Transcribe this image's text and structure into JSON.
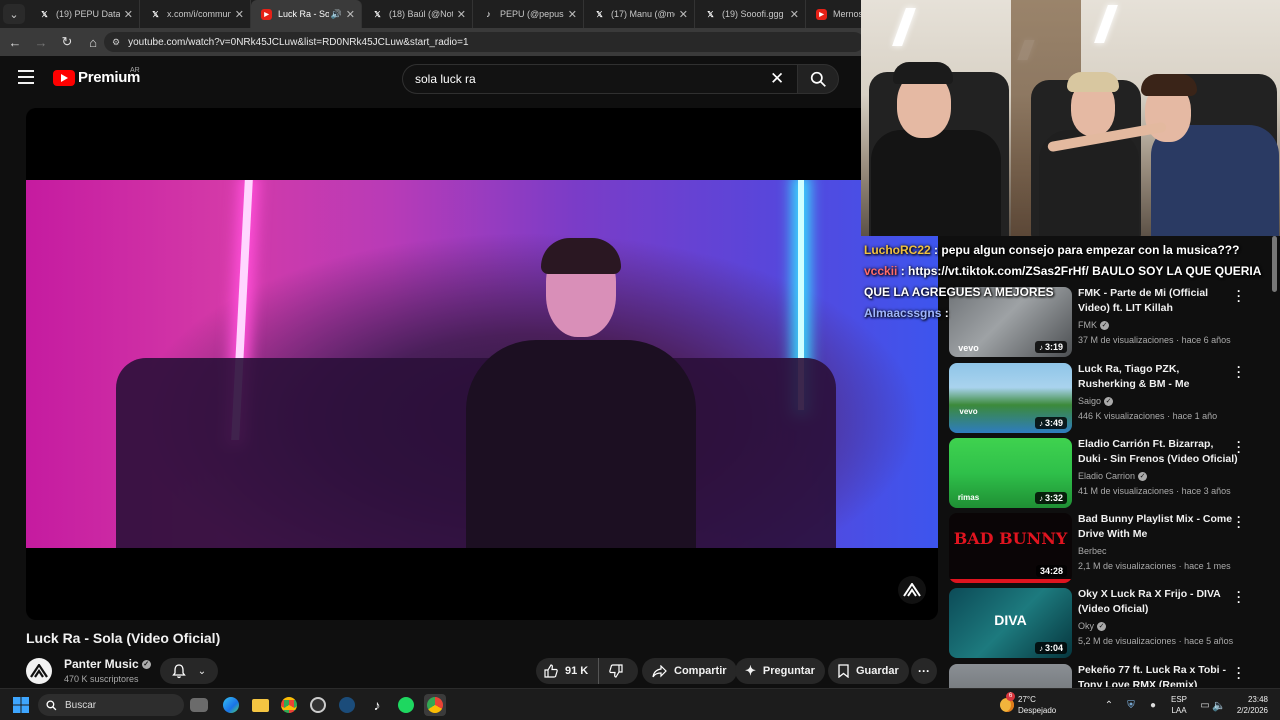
{
  "browser": {
    "tabs": [
      {
        "label": "(19) PEPU Data (@",
        "icon": "x-icon",
        "active": false
      },
      {
        "label": "x.com/i/commun",
        "icon": "x-icon",
        "active": false
      },
      {
        "label": "Luck Ra - Sola",
        "icon": "youtube-icon",
        "active": true
      },
      {
        "label": "(18) Baúl (@NotB",
        "icon": "x-icon",
        "active": false
      },
      {
        "label": "PEPU (@pepuson",
        "icon": "tiktok-icon",
        "active": false
      },
      {
        "label": "(17) Manu (@me",
        "icon": "x-icon",
        "active": false
      },
      {
        "label": "(19) Sooofi.ggg e",
        "icon": "x-icon",
        "active": false
      },
      {
        "label": "Mernosket",
        "icon": "youtube-icon",
        "active": false
      }
    ],
    "url": "youtube.com/watch?v=0NRk45JCLuw&list=RD0NRk45JCLuw&start_radio=1"
  },
  "youtube": {
    "logo_text": "Premium",
    "country_code": "AR",
    "search_value": "sola luck ra"
  },
  "video": {
    "title": "Luck Ra - Sola (Video Oficial)",
    "channel": "Panter Music",
    "subscribers": "470 K suscriptores",
    "likes": "91 K",
    "share_label": "Compartir",
    "ask_label": "Preguntar",
    "save_label": "Guardar"
  },
  "chat": [
    {
      "user": "LuchoRC22",
      "user_color": "#f0c040",
      "message": "pepu algun consejo para empezar con la musica???"
    },
    {
      "user": "vcckii",
      "user_color": "#ff6b6b",
      "message": "https://vt.tiktok.com/ZSas2FrHf/ BAULO SOY LA QUE QUERIA QUE LA AGREGUES A MEJORES"
    },
    {
      "user": "Almaacssgns",
      "user_color": "#9fb6ff",
      "message": ""
    }
  ],
  "recommendations": [
    {
      "title": "FMK - Parte de Mi (Official Video) ft. LIT Killah",
      "channel": "FMK",
      "verified": true,
      "views": "37 M de visualizaciones",
      "age": "hace 6 años",
      "duration": "3:19",
      "thumb_label": "vevo"
    },
    {
      "title": "Luck Ra, Tiago PZK, Rusherking & BM - Me extrañaras (De La ...",
      "channel": "Saigo",
      "verified": true,
      "views": "446 K visualizaciones",
      "age": "hace 1 año",
      "duration": "3:49",
      "thumb_label": "vevo"
    },
    {
      "title": "Eladio Carrión Ft. Bizarrap, Duki - Sin Frenos (Video Oficial)",
      "channel": "Eladio Carrion",
      "verified": true,
      "views": "41 M de visualizaciones",
      "age": "hace 3 años",
      "duration": "3:32",
      "thumb_label": "rimas"
    },
    {
      "title": "Bad Bunny Playlist Mix - Come Drive With Me",
      "channel": "Berbec",
      "verified": false,
      "views": "2,1 M de visualizaciones",
      "age": "hace 1 mes",
      "duration": "34:28",
      "thumb_label": "BAD BUNNY"
    },
    {
      "title": "Oky X Luck Ra X Frijo - DIVA (Video Oficial)",
      "channel": "Oky",
      "verified": true,
      "views": "5,2 M de visualizaciones",
      "age": "hace 5 años",
      "duration": "3:04",
      "thumb_label": "DIVA"
    },
    {
      "title": "Pekeño 77 ft. Luck Ra x Tobi - Tony Love RMX (Remix)",
      "channel": "",
      "verified": false,
      "views": "",
      "age": "",
      "duration": "",
      "thumb_label": ""
    }
  ],
  "taskbar": {
    "search_label": "Buscar",
    "weather_temp": "27°C",
    "weather_desc": "Despejado",
    "weather_badge": "6",
    "lang_line1": "ESP",
    "lang_line2": "LAA",
    "time": "23:48",
    "date": "2/2/2026"
  }
}
